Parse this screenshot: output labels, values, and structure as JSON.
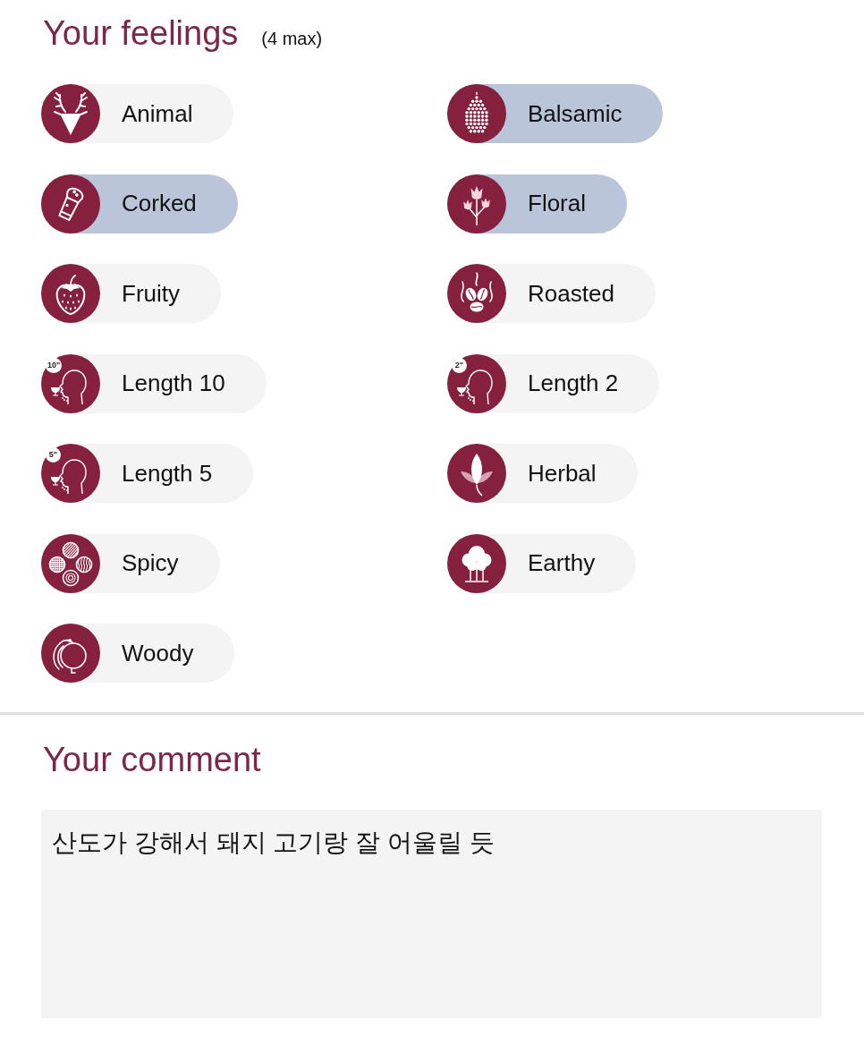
{
  "feelings": {
    "title": "Your feelings",
    "limit_note": "(4 max)",
    "items": [
      {
        "label": "Animal",
        "selected": false
      },
      {
        "label": "Balsamic",
        "selected": true
      },
      {
        "label": "Corked",
        "selected": true
      },
      {
        "label": "Floral",
        "selected": true
      },
      {
        "label": "Fruity",
        "selected": false
      },
      {
        "label": "Roasted",
        "selected": false
      },
      {
        "label": "Length 10",
        "badge": "10\"",
        "selected": false
      },
      {
        "label": "Length 2",
        "badge": "2\"",
        "selected": false
      },
      {
        "label": "Length 5",
        "badge": "5\"",
        "selected": false
      },
      {
        "label": "Herbal",
        "selected": false
      },
      {
        "label": "Spicy",
        "selected": false
      },
      {
        "label": "Earthy",
        "selected": false
      },
      {
        "label": "Woody",
        "selected": false
      }
    ]
  },
  "comment": {
    "title": "Your comment",
    "value": "산도가 강해서 돼지 고기랑 잘 어울릴 듯"
  }
}
